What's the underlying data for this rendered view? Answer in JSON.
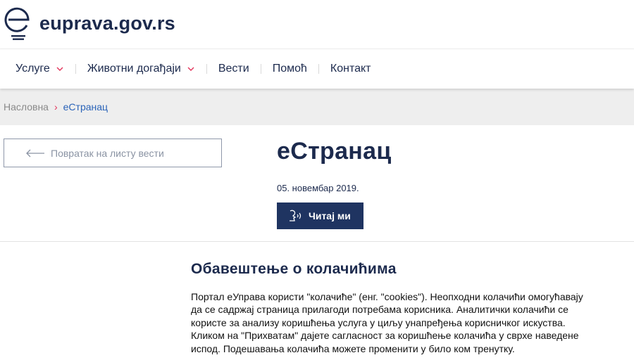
{
  "header": {
    "logo_text": "euprava.gov.rs",
    "logo_icon": "e-letter-logo-icon"
  },
  "nav": {
    "items": [
      {
        "label": "Услуге",
        "has_dropdown": true
      },
      {
        "label": "Животни догађаји",
        "has_dropdown": true
      },
      {
        "label": "Вести",
        "has_dropdown": false
      },
      {
        "label": "Помоћ",
        "has_dropdown": false
      },
      {
        "label": "Контакт",
        "has_dropdown": false
      }
    ]
  },
  "breadcrumb": {
    "home": "Насловна",
    "separator": "›",
    "current": "еСтранац"
  },
  "back_button": {
    "label": "Повратак на листу вести",
    "icon": "arrow-left-icon"
  },
  "article": {
    "title": "еСтранац",
    "date": "05. новембар 2019.",
    "read_button_label": "Читај ми",
    "read_button_icon": "speaker-head-icon"
  },
  "cookie_notice": {
    "title": "Обавештење о колачићима",
    "lines": [
      "Портал еУправа користи \"колачиће\" (енг. \"cookies\"). Неопходни колачићи омогућавају",
      "да се садржај страница прилагоди потребама корисника. Аналитички колачићи се",
      "користе за анализу коришћења услуга у циљу унапређења корисничког искуства.",
      "Кликом на \"Прихватам\" дајете сагласност за коришћење колачића у сврхе наведене",
      "испод. Подешавања колачића можете променити у било ком тренутку."
    ]
  },
  "colors": {
    "brand_navy": "#1c2a4d",
    "button_navy": "#1f3461",
    "breadcrumb_accent": "#e2335a",
    "link_blue": "#2a63b8",
    "breadcrumb_bg": "#eeeeee"
  }
}
